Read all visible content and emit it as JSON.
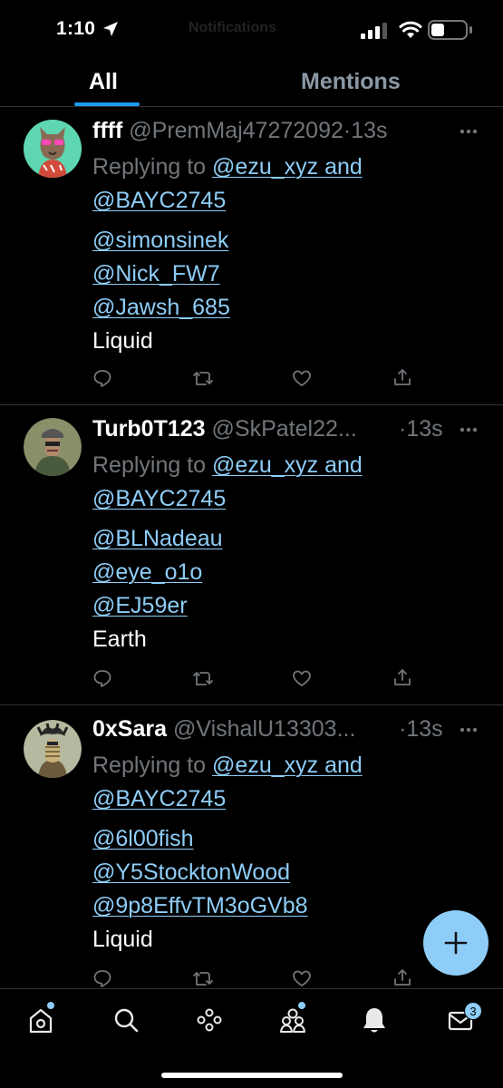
{
  "status_bar": {
    "time": "1:10",
    "ghost_title": "Notifications"
  },
  "tabs": [
    {
      "label": "All"
    },
    {
      "label": "Mentions"
    }
  ],
  "tweets": [
    {
      "name": "ffff",
      "handle": "@PremMaj47272092",
      "time_sep": "·",
      "time": "13s",
      "reply_prefix": "Replying to",
      "reply_targets_1": "@ezu_xyz and",
      "reply_targets_2": "@BAYC2745",
      "mentions": [
        "@simonsinek",
        "@Nick_FW7",
        "@Jawsh_685"
      ],
      "text": "Liquid"
    },
    {
      "name": "Turb0T123",
      "handle": "@SkPatel22...",
      "time_sep": "·",
      "time": "13s",
      "reply_prefix": "Replying to",
      "reply_targets_1": "@ezu_xyz and",
      "reply_targets_2": "@BAYC2745",
      "mentions": [
        "@BLNadeau",
        "@eye_o1o",
        "@EJ59er"
      ],
      "text": "Earth"
    },
    {
      "name": "0xSara",
      "handle": "@VishalU13303...",
      "time_sep": "·",
      "time": "13s",
      "reply_prefix": "Replying to",
      "reply_targets_1": "@ezu_xyz and",
      "reply_targets_2": "@BAYC2745",
      "mentions": [
        "@6l00fish",
        "@Y5StocktonWood",
        "@9p8EffvTM3oGVb8"
      ],
      "text": "Liquid"
    }
  ],
  "bottom_nav": {
    "messages_badge": "3"
  },
  "colors": {
    "accent": "#1d9bf0",
    "link": "#8ecdf8",
    "muted": "#71767b",
    "background": "#000000"
  },
  "icons": [
    "location-arrow-icon",
    "signal-icon",
    "wifi-icon",
    "battery-icon",
    "more-icon",
    "reply-icon",
    "retweet-icon",
    "like-icon",
    "share-icon",
    "compose-plus-icon",
    "home-icon",
    "search-icon",
    "spaces-icon",
    "communities-icon",
    "bell-icon",
    "mail-icon"
  ]
}
